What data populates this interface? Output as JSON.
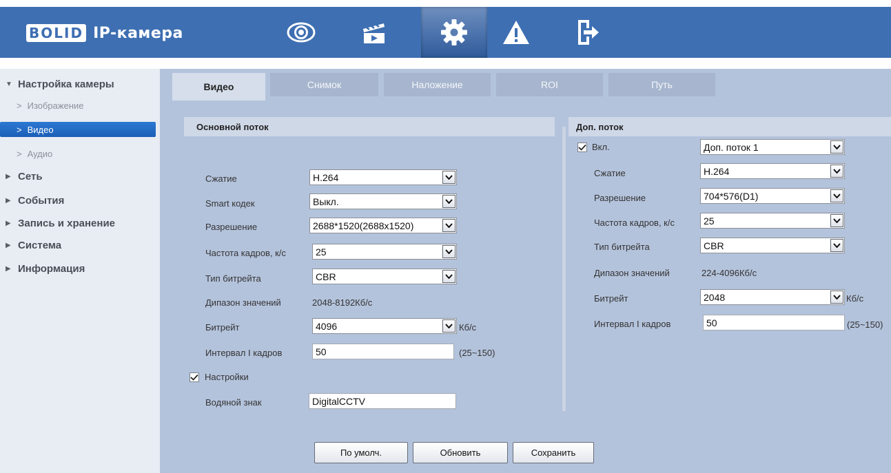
{
  "header": {
    "brand": [
      "B",
      "O",
      "L",
      "I",
      "D"
    ],
    "title": "IP-камера",
    "nav": [
      {
        "icon": "eye-icon"
      },
      {
        "icon": "clapperboard-icon"
      },
      {
        "icon": "gear-icon",
        "active": true
      },
      {
        "icon": "warning-icon"
      },
      {
        "icon": "logout-icon"
      }
    ]
  },
  "sidebar": {
    "camera_settings": "Настройка камеры",
    "image": "Изображение",
    "video": "Видео",
    "audio": "Аудио",
    "network": "Сеть",
    "events": "События",
    "storage": "Запись и хранение",
    "system": "Система",
    "info": "Информация"
  },
  "tabs": [
    "Видео",
    "Снимок",
    "Наложение",
    "ROI",
    "Путь"
  ],
  "main_stream": {
    "header": "Основной поток",
    "compression_label": "Сжатие",
    "compression_value": "H.264",
    "smart_codec_label": "Smart кодек",
    "smart_codec_value": "Выкл.",
    "resolution_label": "Разрешение",
    "resolution_value": "2688*1520(2688x1520)",
    "fps_label": "Частота кадров, к/с",
    "fps_value": "25",
    "bitrate_type_label": "Тип битрейта",
    "bitrate_type_value": "CBR",
    "range_label": "Дипазон значений",
    "range_value": "2048-8192Кб/с",
    "bitrate_label": "Битрейт",
    "bitrate_value": "4096",
    "bitrate_unit": "Кб/с",
    "iframe_label": "Интервал I кадров",
    "iframe_value": "50",
    "iframe_range": "(25~150)",
    "settings_label": "Настройки",
    "watermark_label": "Водяной знак",
    "watermark_value": "DigitalCCTV"
  },
  "sub_stream": {
    "header": "Доп. поток",
    "enable_label": "Вкл.",
    "stream_value": "Доп. поток 1",
    "compression_label": "Сжатие",
    "compression_value": "H.264",
    "resolution_label": "Разрешение",
    "resolution_value": "704*576(D1)",
    "fps_label": "Частота кадров, к/с",
    "fps_value": "25",
    "bitrate_type_label": "Тип битрейта",
    "bitrate_type_value": "CBR",
    "range_label": "Дипазон значений",
    "range_value": "224-4096Кб/с",
    "bitrate_label": "Битрейт",
    "bitrate_value": "2048",
    "bitrate_unit": "Кб/с",
    "iframe_label": "Интервал I кадров",
    "iframe_value": "50",
    "iframe_range": "(25~150)"
  },
  "buttons": {
    "default": "По умолч.",
    "refresh": "Обновить",
    "save": "Сохранить"
  },
  "colors": {
    "header_bg": "#3e6fb2",
    "sidebar_selected": "#1c5fb7",
    "main_bg": "#b4c3dc"
  }
}
